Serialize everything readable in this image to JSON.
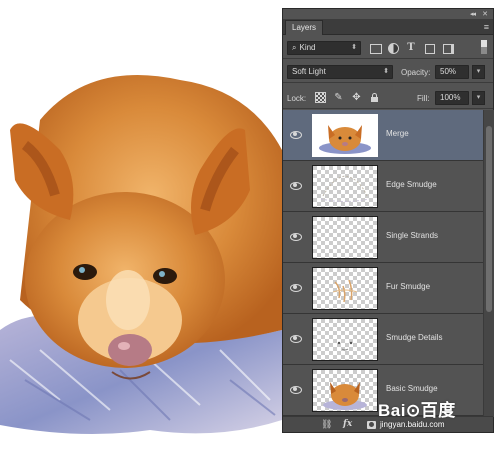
{
  "panel": {
    "tab_label": "Layers",
    "collapse_glyph": "◂◂",
    "close_glyph": "✕",
    "menu_glyph": "≡"
  },
  "filter": {
    "kind_label": "Kind",
    "search_glyph": "⌕"
  },
  "blend": {
    "mode_label": "Soft Light",
    "opacity_label": "Opacity:",
    "opacity_value": "50%"
  },
  "lock": {
    "lock_label": "Lock:",
    "fill_label": "Fill:",
    "fill_value": "100%"
  },
  "layers": [
    {
      "name": "Merge",
      "selected": true,
      "visible": true
    },
    {
      "name": "Edge Smudge",
      "selected": false,
      "visible": true
    },
    {
      "name": "Single Strands",
      "selected": false,
      "visible": true
    },
    {
      "name": "Fur Smudge",
      "selected": false,
      "visible": true
    },
    {
      "name": "Smudge Details",
      "selected": false,
      "visible": true
    },
    {
      "name": "Basic Smudge",
      "selected": false,
      "visible": true
    }
  ],
  "bottom_bar": {
    "link_glyph": "⛓",
    "fx_label": "fx"
  },
  "watermark": {
    "brand": "Bai⊙百度",
    "site": "jingyan.baidu.com"
  },
  "colors": {
    "panel_bg": "#535353",
    "selected_layer": "#5f6a7d",
    "fur_orange": "#d98a3a",
    "rug_blue": "#8a94c8"
  }
}
